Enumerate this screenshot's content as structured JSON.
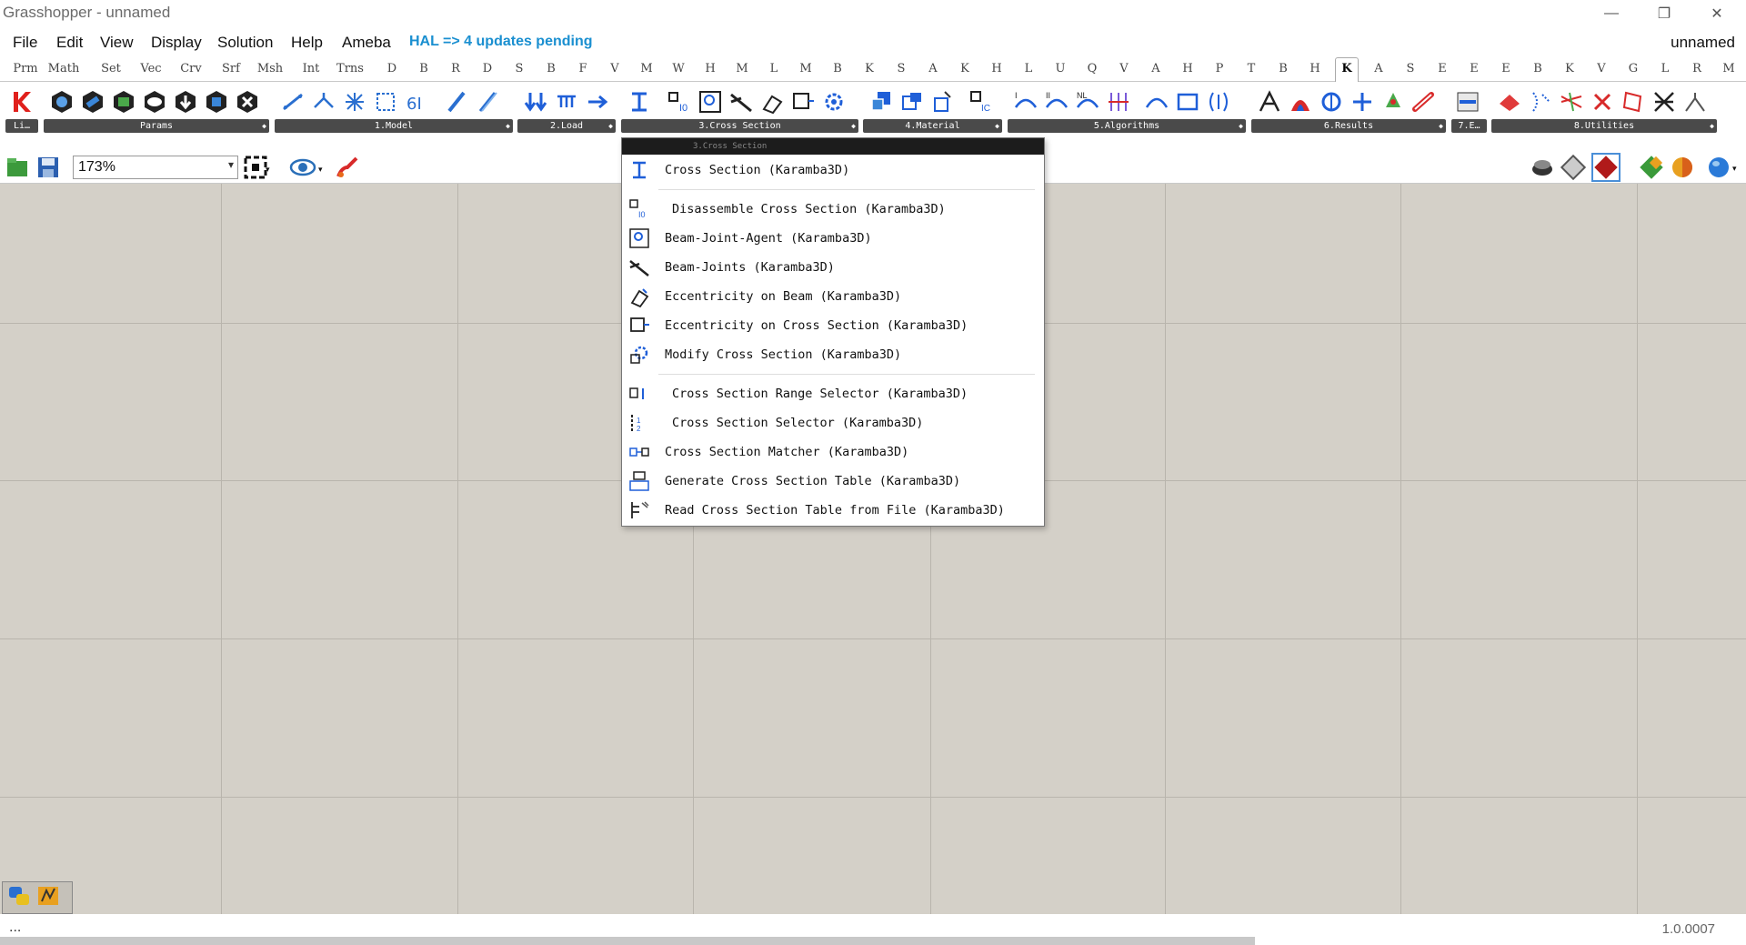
{
  "window": {
    "title": "Grasshopper - unnamed",
    "controls": [
      "—",
      "❐",
      "✕"
    ]
  },
  "menubar": {
    "items": [
      "File",
      "Edit",
      "View",
      "Display",
      "Solution",
      "Help",
      "Ameba"
    ],
    "hal": "HAL => 4 updates pending",
    "doc_name": "unnamed"
  },
  "tabs": {
    "items": [
      "Prm",
      "Math",
      "Set",
      "Vec",
      "Crv",
      "Srf",
      "Msh",
      "Int",
      "Trns",
      "D",
      "B",
      "R",
      "D",
      "S",
      "B",
      "F",
      "V",
      "M",
      "W",
      "H",
      "M",
      "L",
      "M",
      "B",
      "K",
      "S",
      "A",
      "K",
      "H",
      "L",
      "U",
      "Q",
      "V",
      "A",
      "H",
      "P",
      "T",
      "B",
      "H",
      "K",
      "A",
      "S",
      "E",
      "E",
      "E",
      "B",
      "K",
      "V",
      "G",
      "L",
      "R",
      "M"
    ],
    "active_index": 39
  },
  "ribbon": {
    "groups": [
      {
        "label": "Li…"
      },
      {
        "label": "Params"
      },
      {
        "label": "1.Model"
      },
      {
        "label": "2.Load"
      },
      {
        "label": "3.Cross Section"
      },
      {
        "label": "4.Material"
      },
      {
        "label": "5.Algorithms"
      },
      {
        "label": "6.Results"
      },
      {
        "label": "7.E…"
      },
      {
        "label": "8.Utilities"
      }
    ]
  },
  "canvas_toolbar": {
    "zoom": "173%"
  },
  "dropdown": {
    "header": "3.Cross Section",
    "items": [
      {
        "label": "Cross Section (Karamba3D)",
        "icon": "cross-section-icon"
      },
      {
        "label": "Disassemble Cross Section (Karamba3D)",
        "icon": "disassemble-icon"
      },
      {
        "label": "Beam-Joint-Agent (Karamba3D)",
        "icon": "beam-joint-agent-icon"
      },
      {
        "label": "Beam-Joints (Karamba3D)",
        "icon": "beam-joints-icon"
      },
      {
        "label": "Eccentricity on Beam (Karamba3D)",
        "icon": "eccentricity-beam-icon"
      },
      {
        "label": "Eccentricity on Cross Section (Karamba3D)",
        "icon": "eccentricity-section-icon"
      },
      {
        "label": "Modify Cross Section (Karamba3D)",
        "icon": "modify-section-icon"
      },
      {
        "label": "Cross Section Range Selector (Karamba3D)",
        "icon": "range-selector-icon"
      },
      {
        "label": "Cross Section Selector (Karamba3D)",
        "icon": "section-selector-icon"
      },
      {
        "label": "Cross Section Matcher (Karamba3D)",
        "icon": "section-matcher-icon"
      },
      {
        "label": "Generate Cross Section Table (Karamba3D)",
        "icon": "generate-table-icon"
      },
      {
        "label": "Read Cross Section Table from File (Karamba3D)",
        "icon": "read-table-icon"
      }
    ]
  },
  "status": {
    "text": "...",
    "version": "1.0.0007"
  },
  "colors": {
    "canvas": "#d4d0c8",
    "grid": "#b9b5ad",
    "hal": "#1a8fd0",
    "group_label_bg": "#4a4a4a"
  }
}
